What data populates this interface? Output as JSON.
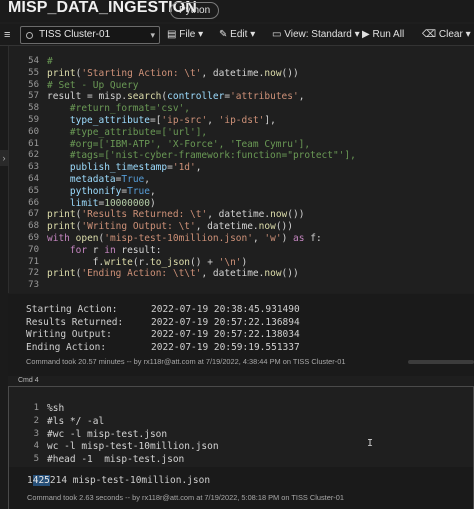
{
  "header": {
    "title": "MISP_DATA_INGESTION",
    "language": "Python"
  },
  "toolbar": {
    "cluster": "TISS Cluster-01",
    "file": "File",
    "edit": "Edit",
    "view": "View: Standard",
    "run_all": "Run All",
    "clear": "Clear"
  },
  "cell1": {
    "lines": [
      {
        "n": "54",
        "text": "#"
      },
      {
        "n": "55",
        "text": "print('Starting Action: \\t', datetime.now())"
      },
      {
        "n": "56",
        "text": "# Set - Up Query"
      },
      {
        "n": "57",
        "text": "result = misp.search(controller='attributes',"
      },
      {
        "n": "58",
        "text": "    #return_format='csv',"
      },
      {
        "n": "59",
        "text": "    type_attribute=['ip-src', 'ip-dst'],"
      },
      {
        "n": "60",
        "text": "    #type_attribute=['url'],"
      },
      {
        "n": "61",
        "text": "    #org=['IBM-ATP', 'X-Force', 'Team Cymru'],"
      },
      {
        "n": "62",
        "text": "    #tags=['nist-cyber-framework:function=\"protect\"'],"
      },
      {
        "n": "63",
        "text": "    publish_timestamp='1d',"
      },
      {
        "n": "64",
        "text": "    metadata=True,"
      },
      {
        "n": "65",
        "text": "    pythonify=True,"
      },
      {
        "n": "66",
        "text": "    limit=10000000)"
      },
      {
        "n": "67",
        "text": "print('Results Returned: \\t', datetime.now())"
      },
      {
        "n": "68",
        "text": "print('Writing Output: \\t', datetime.now())"
      },
      {
        "n": "69",
        "text": "with open('misp-test-10million.json', 'w') as f:"
      },
      {
        "n": "70",
        "text": "    for r in result:"
      },
      {
        "n": "71",
        "text": "        f.write(r.to_json() + '\\n')"
      },
      {
        "n": "72",
        "text": "print('Ending Action: \\t\\t', datetime.now())"
      },
      {
        "n": "73",
        "text": ""
      }
    ],
    "output": [
      {
        "label": "Starting Action:",
        "value": "2022-07-19 20:38:45.931490"
      },
      {
        "label": "Results Returned:",
        "value": "2022-07-19 20:57:22.136894"
      },
      {
        "label": "Writing Output:",
        "value": "2022-07-19 20:57:22.138034"
      },
      {
        "label": "Ending Action:",
        "value": "2022-07-19 20:59:19.551337"
      }
    ],
    "command_took": "Command took 20.57 minutes -- by rx118r@att.com at 7/19/2022, 4:38:44 PM on TISS Cluster-01"
  },
  "cell2": {
    "label": "Cmd 4",
    "lines": [
      {
        "n": "1",
        "text": "%sh"
      },
      {
        "n": "2",
        "text": "#ls */ -al"
      },
      {
        "n": "3",
        "text": "#wc -l misp-test.json"
      },
      {
        "n": "4",
        "text": "wc -l misp-test-10million.json"
      },
      {
        "n": "5",
        "text": "#head -1  misp-test.json"
      }
    ],
    "output_highlight": "425",
    "output_pre": "1",
    "output_post": "214 misp-test-10million.json",
    "command_took": "Command took 2.63 seconds -- by rx118r@att.com at 7/19/2022, 5:08:18 PM on TISS Cluster-01"
  }
}
